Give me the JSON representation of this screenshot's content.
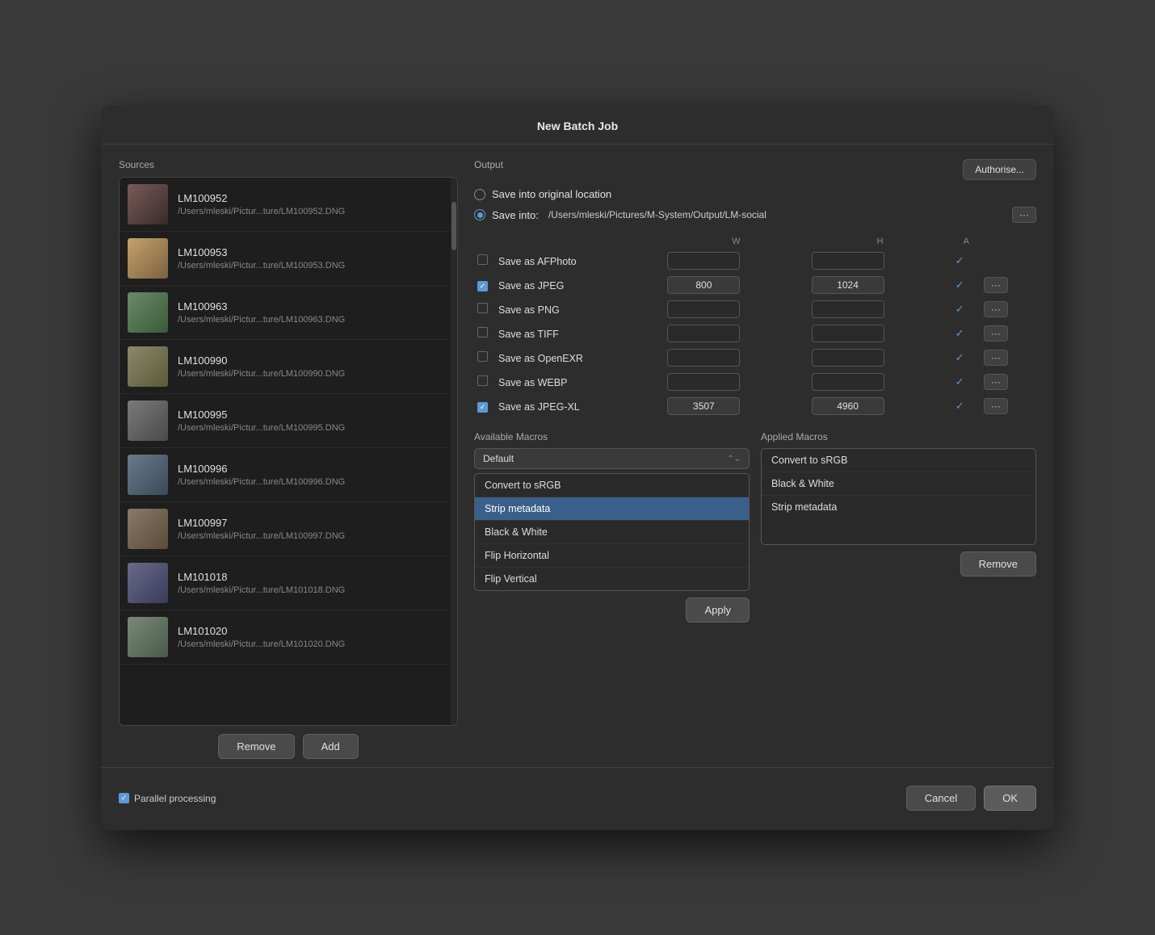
{
  "dialog": {
    "title": "New Batch Job"
  },
  "sources": {
    "label": "Sources",
    "items": [
      {
        "id": "LM100952",
        "name": "LM100952",
        "path": "/Users/mleski/Pictur...ture/LM100952.DNG",
        "thumb_class": "thumb-p1"
      },
      {
        "id": "LM100953",
        "name": "LM100953",
        "path": "/Users/mleski/Pictur...ture/LM100953.DNG",
        "thumb_class": "thumb-p2"
      },
      {
        "id": "LM100963",
        "name": "LM100963",
        "path": "/Users/mleski/Pictur...ture/LM100963.DNG",
        "thumb_class": "thumb-p3"
      },
      {
        "id": "LM100990",
        "name": "LM100990",
        "path": "/Users/mleski/Pictur...ture/LM100990.DNG",
        "thumb_class": "thumb-p4"
      },
      {
        "id": "LM100995",
        "name": "LM100995",
        "path": "/Users/mleski/Pictur...ture/LM100995.DNG",
        "thumb_class": "thumb-p5"
      },
      {
        "id": "LM100996",
        "name": "LM100996",
        "path": "/Users/mleski/Pictur...ture/LM100996.DNG",
        "thumb_class": "thumb-p6"
      },
      {
        "id": "LM100997",
        "name": "LM100997",
        "path": "/Users/mleski/Pictur...ture/LM100997.DNG",
        "thumb_class": "thumb-p7"
      },
      {
        "id": "LM101018",
        "name": "LM101018",
        "path": "/Users/mleski/Pictur...ture/LM101018.DNG",
        "thumb_class": "thumb-p8"
      },
      {
        "id": "LM101020",
        "name": "LM101020",
        "path": "/Users/mleski/Pictur...ture/LM101020.DNG",
        "thumb_class": "thumb-p9"
      }
    ],
    "remove_label": "Remove",
    "add_label": "Add"
  },
  "output": {
    "label": "Output",
    "save_original_label": "Save into original location",
    "save_into_label": "Save into:",
    "save_path": "/Users/mleski/Pictures/M-System/Output/LM-social",
    "authorise_label": "Authorise...",
    "col_w": "W",
    "col_h": "H",
    "col_a": "A",
    "formats": [
      {
        "label": "Save as AFPhoto",
        "checked": false,
        "w": "",
        "h": "",
        "has_dots": false
      },
      {
        "label": "Save as JPEG",
        "checked": true,
        "w": "800",
        "h": "1024",
        "has_dots": true
      },
      {
        "label": "Save as PNG",
        "checked": false,
        "w": "",
        "h": "",
        "has_dots": true
      },
      {
        "label": "Save as TIFF",
        "checked": false,
        "w": "",
        "h": "",
        "has_dots": true
      },
      {
        "label": "Save as OpenEXR",
        "checked": false,
        "w": "",
        "h": "",
        "has_dots": true
      },
      {
        "label": "Save as WEBP",
        "checked": false,
        "w": "",
        "h": "",
        "has_dots": true
      },
      {
        "label": "Save as JPEG-XL",
        "checked": true,
        "w": "3507",
        "h": "4960",
        "has_dots": true
      }
    ]
  },
  "available_macros": {
    "label": "Available Macros",
    "dropdown_value": "Default",
    "items": [
      {
        "label": "Convert to sRGB",
        "selected": false
      },
      {
        "label": "Strip metadata",
        "selected": true
      },
      {
        "label": "Black & White",
        "selected": false
      },
      {
        "label": "Flip Horizontal",
        "selected": false
      },
      {
        "label": "Flip Vertical",
        "selected": false
      }
    ],
    "apply_label": "Apply"
  },
  "applied_macros": {
    "label": "Applied Macros",
    "items": [
      {
        "label": "Convert to sRGB"
      },
      {
        "label": "Black & White"
      },
      {
        "label": "Strip metadata"
      }
    ],
    "remove_label": "Remove"
  },
  "bottom": {
    "parallel_label": "Parallel processing",
    "cancel_label": "Cancel",
    "ok_label": "OK"
  }
}
